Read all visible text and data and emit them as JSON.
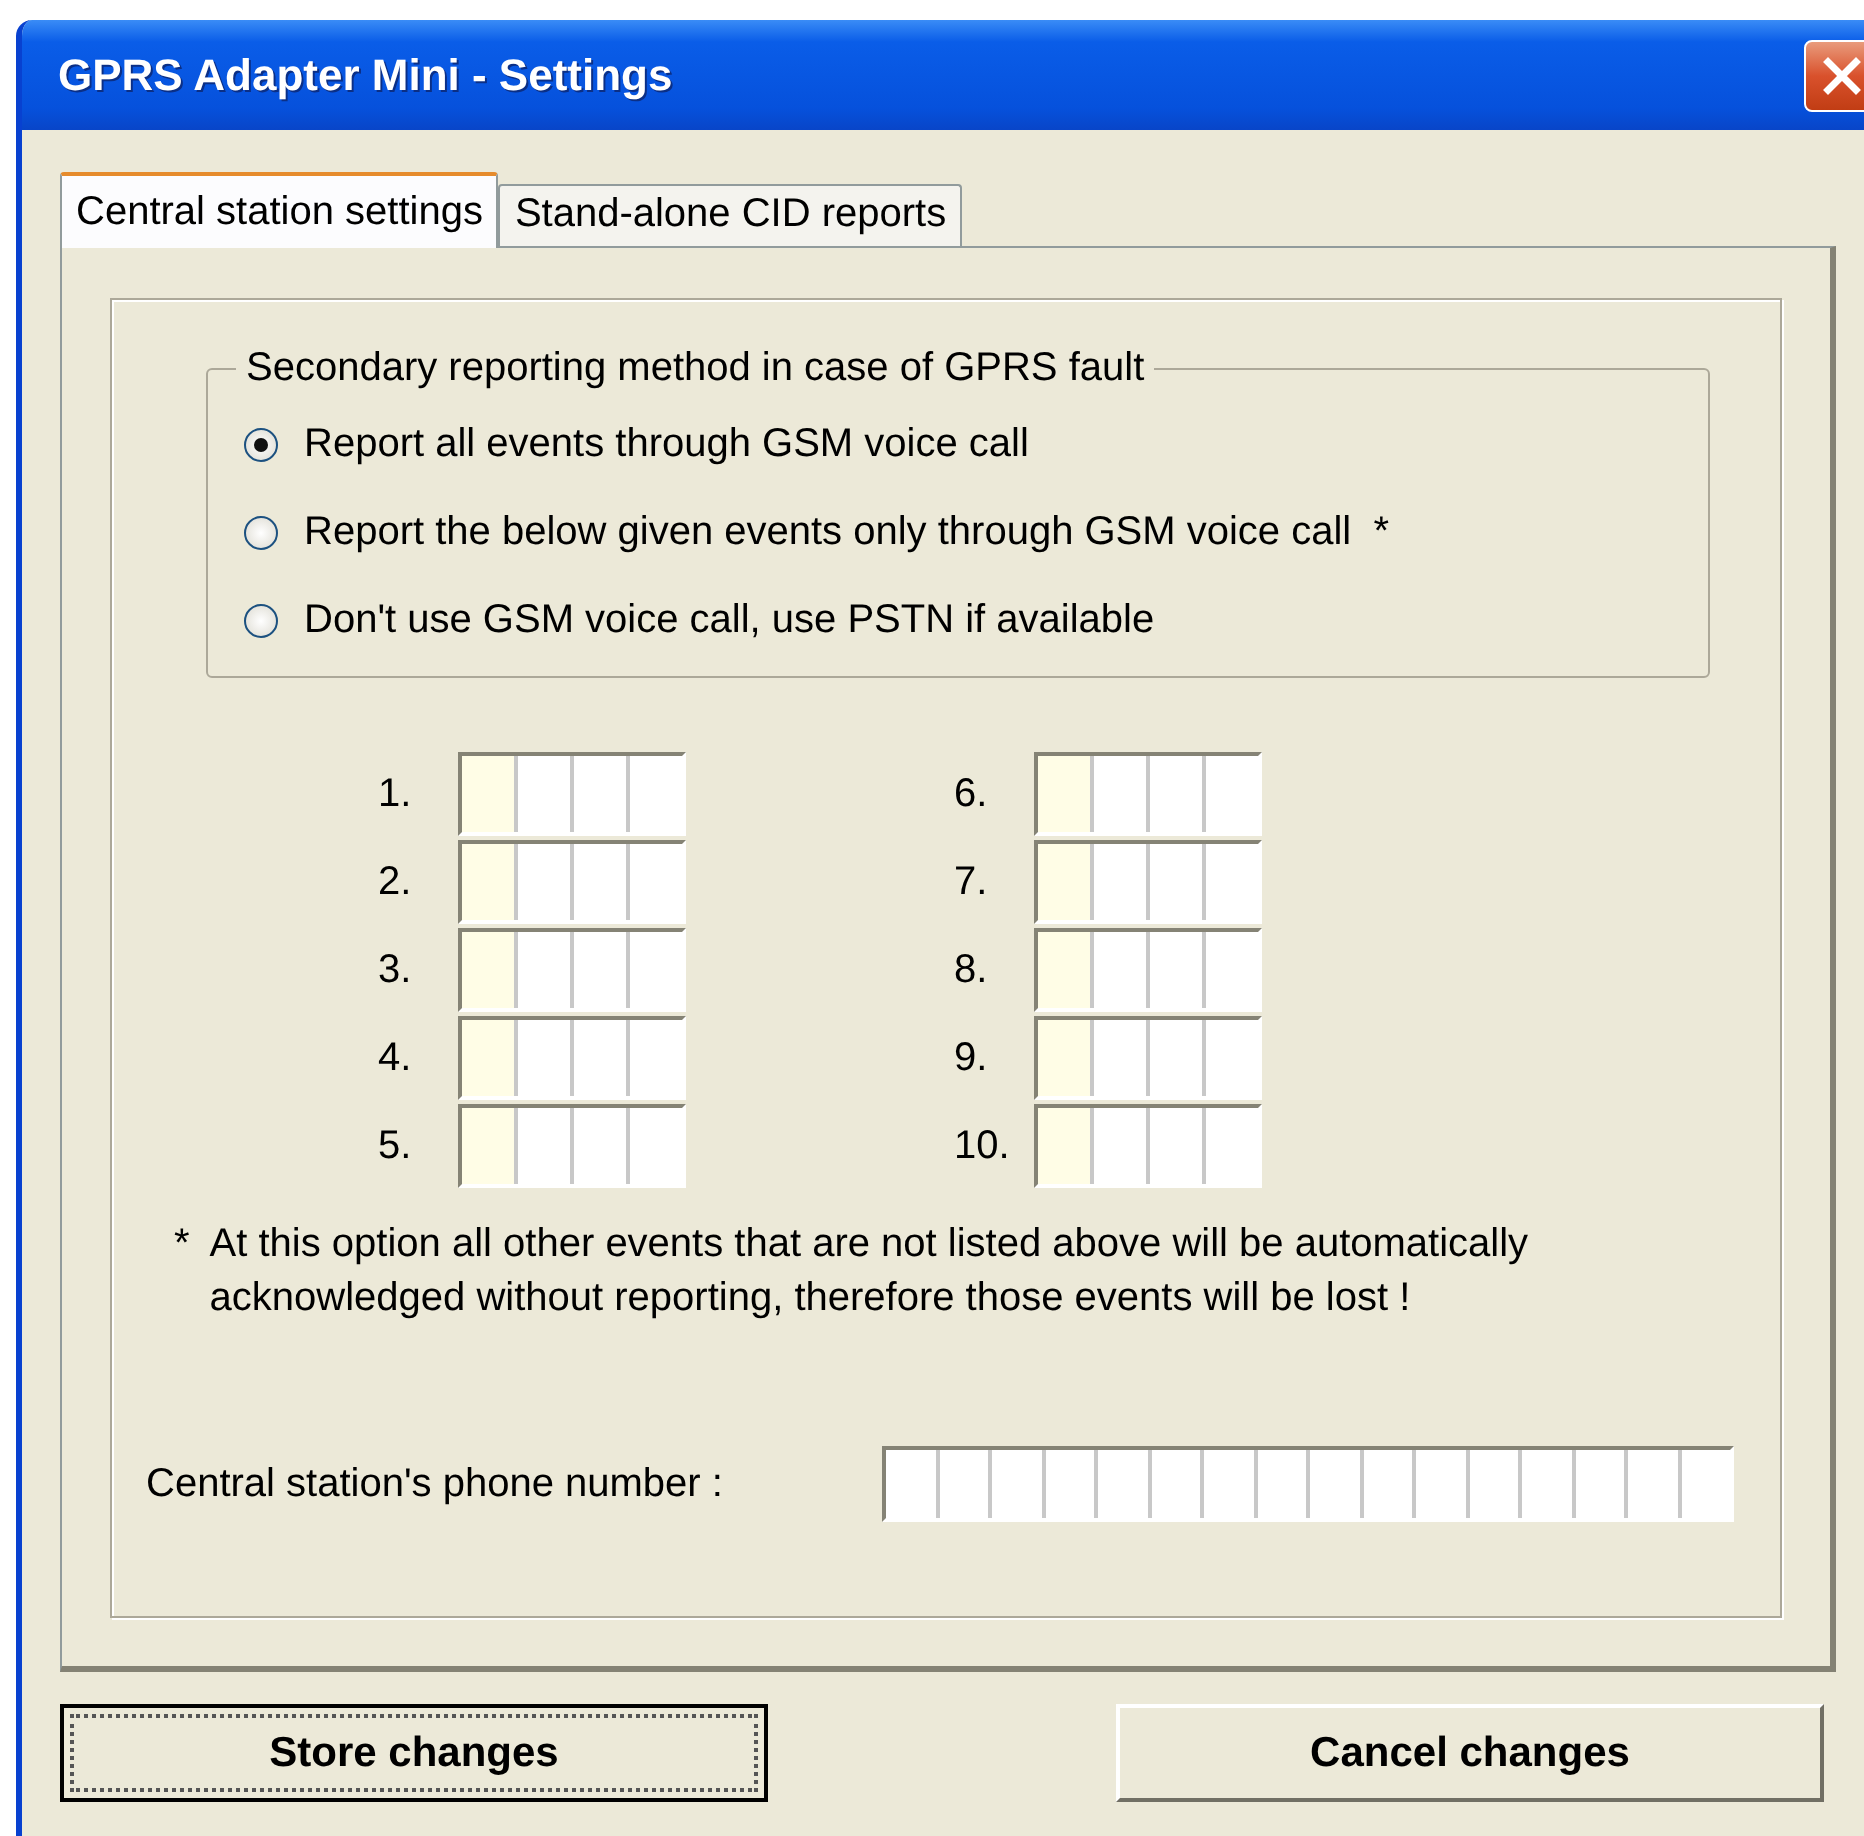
{
  "window": {
    "title": "GPRS Adapter Mini - Settings"
  },
  "tabs": [
    {
      "label": "Central station settings",
      "selected": true
    },
    {
      "label": "Stand-alone CID reports",
      "selected": false
    }
  ],
  "reporting_group": {
    "legend": "Secondary reporting method in case of GPRS fault",
    "options": [
      {
        "label": "Report all events through GSM voice call",
        "selected": true
      },
      {
        "label": "Report the below given events only through GSM voice call  *",
        "selected": false
      },
      {
        "label": "Don't use GSM voice call, use PSTN if available",
        "selected": false
      }
    ]
  },
  "events": [
    {
      "number": "1."
    },
    {
      "number": "2."
    },
    {
      "number": "3."
    },
    {
      "number": "4."
    },
    {
      "number": "5."
    },
    {
      "number": "6."
    },
    {
      "number": "7."
    },
    {
      "number": "8."
    },
    {
      "number": "9."
    },
    {
      "number": "10."
    }
  ],
  "footnote": {
    "mark": "*",
    "text": "At this option all other events that are not listed above will be automatically acknowledged without reporting, therefore those events will be lost !"
  },
  "phone": {
    "label": "Central station's phone number :"
  },
  "buttons": [
    {
      "label": "Store changes",
      "focused": true
    },
    {
      "label": "Cancel changes",
      "focused": false
    }
  ]
}
